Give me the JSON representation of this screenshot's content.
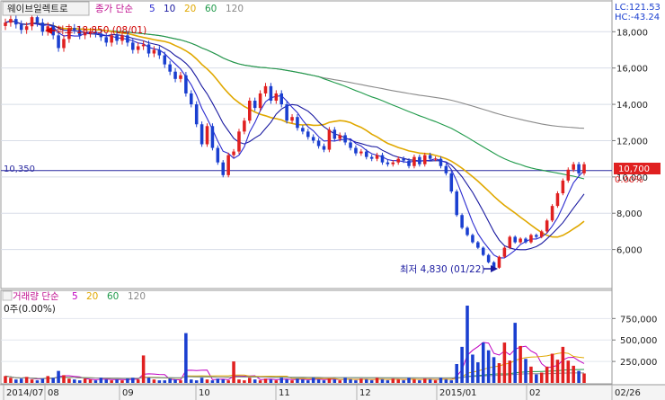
{
  "chart": {
    "stock_name": "웨이브일렉트로",
    "ma_legend": {
      "prefix": "종가 단순",
      "periods": [
        "5",
        "10",
        "20",
        "60",
        "120"
      ],
      "colors": [
        "#2b2bd0",
        "#1a1aa0",
        "#e0a800",
        "#1f9a4a",
        "#8a8a8a"
      ]
    },
    "lc_label": "LC:121.53",
    "hc_label": "HC:-43.24",
    "high_annotation": "최고 18,850 (08/01)",
    "low_annotation": "최저 4,830 (01/22)",
    "ref_line_label": "10,350",
    "current_price_badge": "10,700",
    "pct_label": "0.00%",
    "volume_legend": {
      "prefix": "거래량 단순",
      "periods": [
        "5",
        "20",
        "60",
        "120"
      ],
      "colors": [
        "#c000c0",
        "#e0a800",
        "#1f9a4a",
        "#8a8a8a"
      ]
    },
    "volume_value_label": "0주(0.00%)",
    "x_axis_labels": [
      "2014/07",
      "08",
      "09",
      "10",
      "11",
      "12",
      "2015/01",
      "02",
      "02/26"
    ],
    "price_ticks": [
      "18,000",
      "16,000",
      "14,000",
      "12,000",
      "10,000",
      "8,000",
      "6,000"
    ],
    "volume_ticks": [
      "750,000",
      "500,000",
      "250,000"
    ],
    "colors": {
      "up": "#e02020",
      "down": "#1a3fd0",
      "ref_line": "#2a2aa0",
      "badge": "#e02020"
    }
  },
  "chart_data": {
    "type": "candlestick",
    "title": "웨이브일렉트로",
    "price_ylim": [
      4000,
      19500
    ],
    "volume_ylim": [
      0,
      900000
    ],
    "high": {
      "value": 18850,
      "date": "08/01"
    },
    "low": {
      "value": 4830,
      "date": "01/22"
    },
    "reference_line": 10350,
    "last_close": 10700,
    "closes": [
      18500,
      18700,
      18400,
      18100,
      18300,
      18800,
      18500,
      18000,
      18300,
      17800,
      17100,
      17600,
      18200,
      18100,
      17800,
      17900,
      18000,
      17900,
      17700,
      17400,
      17800,
      17500,
      17800,
      17400,
      17000,
      17200,
      17300,
      16800,
      17000,
      16700,
      16200,
      15800,
      15400,
      15600,
      14600,
      14000,
      12900,
      11800,
      12800,
      11600,
      10800,
      10100,
      11200,
      11400,
      12500,
      13100,
      14200,
      13800,
      14600,
      15000,
      14200,
      14600,
      14000,
      13100,
      13300,
      12700,
      12500,
      12200,
      12000,
      11700,
      11500,
      12600,
      12100,
      12300,
      11900,
      11600,
      11300,
      11400,
      11100,
      11000,
      11200,
      10800,
      10700,
      10800,
      11000,
      10900,
      10600,
      11100,
      10700,
      11200,
      11000,
      11000,
      10600,
      10200,
      9200,
      7900,
      7200,
      6800,
      6400,
      6100,
      5700,
      5300,
      5000,
      5600,
      6100,
      6700,
      6400,
      6600,
      6400,
      6800,
      6700,
      7000,
      7600,
      8400,
      9100,
      9800,
      10400,
      10700,
      10200,
      10700
    ],
    "volumes": [
      80000,
      60000,
      40000,
      50000,
      70000,
      40000,
      30000,
      50000,
      80000,
      60000,
      140000,
      90000,
      50000,
      40000,
      30000,
      50000,
      40000,
      30000,
      60000,
      40000,
      30000,
      40000,
      30000,
      50000,
      60000,
      40000,
      320000,
      60000,
      40000,
      30000,
      30000,
      50000,
      40000,
      30000,
      580000,
      40000,
      30000,
      60000,
      40000,
      30000,
      50000,
      40000,
      30000,
      250000,
      40000,
      30000,
      60000,
      40000,
      30000,
      50000,
      40000,
      30000,
      60000,
      40000,
      30000,
      50000,
      40000,
      30000,
      60000,
      40000,
      30000,
      50000,
      40000,
      30000,
      60000,
      40000,
      30000,
      50000,
      40000,
      30000,
      60000,
      40000,
      30000,
      50000,
      40000,
      30000,
      60000,
      40000,
      30000,
      50000,
      40000,
      30000,
      60000,
      40000,
      30000,
      220000,
      420000,
      900000,
      330000,
      240000,
      470000,
      380000,
      300000,
      230000,
      470000,
      260000,
      700000,
      430000,
      280000,
      190000,
      100000,
      120000,
      190000,
      340000,
      270000,
      420000,
      260000,
      200000,
      140000,
      110000
    ]
  }
}
